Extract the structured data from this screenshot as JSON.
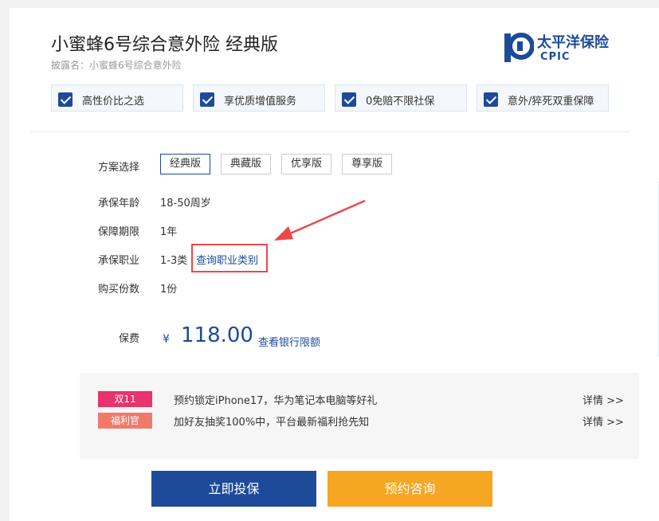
{
  "product": {
    "title": "小蜜蜂6号综合意外险  经典版",
    "disclosure_name": "披露名：小蜜蜂6号综合意外险"
  },
  "brand": {
    "name_cn": "太平洋保险",
    "name_en": "CPIC",
    "color": "#1d4b9a"
  },
  "features": [
    {
      "label": "高性价比之选",
      "icon": "checkbox-checked-icon"
    },
    {
      "label": "享优质增值服务",
      "icon": "checkbox-checked-icon"
    },
    {
      "label": "0免赔不限社保",
      "icon": "checkbox-checked-icon"
    },
    {
      "label": "意外/猝死双重保障",
      "icon": "checkbox-checked-icon"
    }
  ],
  "plan": {
    "label": "方案选择",
    "options": [
      "经典版",
      "典藏版",
      "优享版",
      "尊享版"
    ],
    "selected": "经典版"
  },
  "details": {
    "age": {
      "label": "承保年龄",
      "value": "18-50周岁"
    },
    "period": {
      "label": "保障期限",
      "value": "1年"
    },
    "occupation": {
      "label": "承保职业",
      "value": "1-3类",
      "link": "查询职业类别"
    },
    "quantity": {
      "label": "购买份数",
      "value": "1份"
    }
  },
  "premium": {
    "label": "保费",
    "currency": "¥",
    "amount": "118.00",
    "bank_link": "查看银行限额"
  },
  "promos": [
    {
      "badge": "双11",
      "badge_color": "#e8336d",
      "text": "预约锁定iPhone17，华为笔记本电脑等好礼",
      "detail": "详情 >>"
    },
    {
      "badge": "福利官",
      "badge_color": "#f07a6a",
      "text": "加好友抽奖100%中，平台最新福利抢先知",
      "detail": "详情 >>"
    }
  ],
  "actions": {
    "buy": "立即投保",
    "consult": "预约咨询",
    "buy_color": "#1d4b9a",
    "consult_color": "#f5a623"
  },
  "annotation": {
    "highlight_color": "#e84a4a"
  }
}
